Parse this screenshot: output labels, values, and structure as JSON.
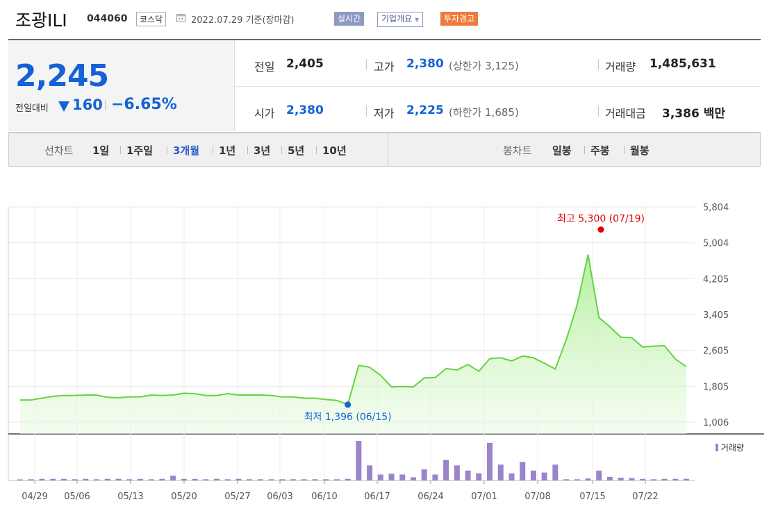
{
  "header": {
    "name": "조광ILI",
    "code": "044060",
    "market": "코스닥",
    "date_text": "2022.07.29 기준(장마감)",
    "btn_realtime": "실시간",
    "btn_company": "기업개요",
    "btn_warning": "투자경고"
  },
  "quote": {
    "price": "2,245",
    "prev_label": "전일대비",
    "change": "160",
    "change_pct": "−6.65%",
    "prev_close_label": "전일",
    "prev_close": "2,405",
    "open_label": "시가",
    "open": "2,380",
    "high_label": "고가",
    "high": "2,380",
    "upper_limit": "(상한가 3,125)",
    "low_label": "저가",
    "low": "2,225",
    "lower_limit": "(하한가 1,685)",
    "volume_label": "거래량",
    "volume": "1,485,631",
    "amount_label": "거래대금",
    "amount": "3,386 백만"
  },
  "periods": {
    "line_label": "선차트",
    "line_items": [
      "1일",
      "1주일",
      "3개월",
      "1년",
      "3년",
      "5년",
      "10년"
    ],
    "active": "3개월",
    "candle_label": "봉차트",
    "candle_items": [
      "일봉",
      "주봉",
      "월봉"
    ]
  },
  "colors": {
    "up": "#e00000",
    "down": "#1562d6",
    "line": "#63d43f",
    "volume": "#9b84c9"
  },
  "chart_data": {
    "type": "area",
    "y_ticks": [
      "5,804",
      "5,004",
      "4,205",
      "3,405",
      "2,605",
      "1,805",
      "1,006"
    ],
    "y_tick_values": [
      5804,
      5004,
      4205,
      3405,
      2605,
      1805,
      1006
    ],
    "x_ticks": [
      "04/29",
      "05/06",
      "05/13",
      "05/20",
      "05/27",
      "06/03",
      "06/10",
      "06/17",
      "06/24",
      "07/01",
      "07/08",
      "07/15",
      "07/22"
    ],
    "price": [
      1500,
      1500,
      1540,
      1580,
      1600,
      1600,
      1610,
      1610,
      1560,
      1550,
      1570,
      1570,
      1610,
      1600,
      1610,
      1650,
      1640,
      1600,
      1600,
      1640,
      1610,
      1610,
      1610,
      1600,
      1570,
      1570,
      1540,
      1540,
      1510,
      1490,
      1396,
      2270,
      2230,
      2050,
      1790,
      1800,
      1790,
      1990,
      2000,
      2200,
      2170,
      2290,
      2140,
      2420,
      2440,
      2370,
      2480,
      2440,
      2320,
      2190,
      2840,
      3620,
      4740,
      3340,
      3130,
      2900,
      2890,
      2680,
      2700,
      2710,
      2410,
      2245
    ],
    "volume": [
      0.02,
      0.03,
      0.04,
      0.04,
      0.04,
      0.03,
      0.04,
      0.03,
      0.04,
      0.04,
      0.03,
      0.04,
      0.03,
      0.04,
      0.12,
      0.04,
      0.04,
      0.03,
      0.04,
      0.03,
      0.04,
      0.03,
      0.03,
      0.03,
      0.03,
      0.03,
      0.03,
      0.03,
      0.03,
      0.03,
      0.04,
      1.0,
      0.38,
      0.15,
      0.17,
      0.15,
      0.08,
      0.28,
      0.15,
      0.52,
      0.38,
      0.25,
      0.18,
      0.95,
      0.4,
      0.18,
      0.47,
      0.25,
      0.2,
      0.4,
      0.03,
      0.03,
      0.05,
      0.25,
      0.09,
      0.07,
      0.06,
      0.04,
      0.03,
      0.04,
      0.04,
      0.04
    ],
    "high_label": "최고 5,300 (07/19)",
    "high_value": 5300,
    "high_index": 52,
    "low_label": "최저 1,396 (06/15)",
    "low_value": 1396,
    "low_index": 30,
    "volume_legend": "거래량"
  }
}
